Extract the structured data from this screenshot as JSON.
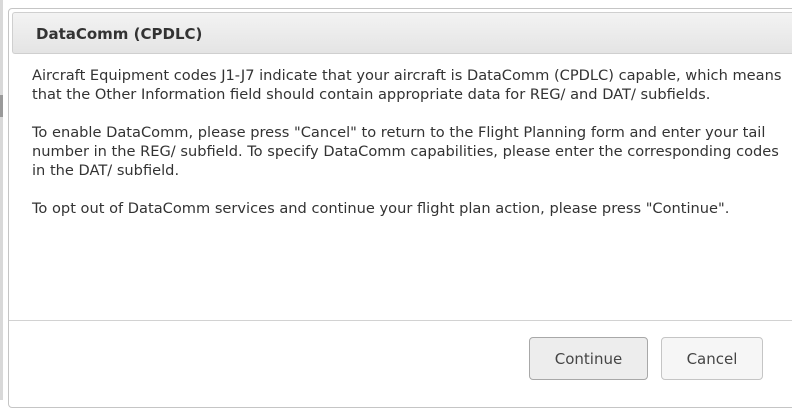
{
  "dialog": {
    "title": "DataComm (CPDLC)",
    "paragraphs": [
      "Aircraft Equipment codes J1-J7 indicate that your aircraft is DataComm (CPDLC) capable, which means that the Other Information field should contain appropriate data for REG/ and DAT/ subfields.",
      "To enable DataComm, please press \"Cancel\" to return to the Flight Planning form and enter your tail number in the REG/ subfield. To specify DataComm capabilities, please enter the corresponding codes in the DAT/ subfield.",
      "To opt out of DataComm services and continue your flight plan action, please press \"Continue\"."
    ],
    "buttons": {
      "continue_label": "Continue",
      "cancel_label": "Cancel"
    }
  },
  "colors": {
    "title_bar": "#e8e8e8",
    "border": "#c5c5c5",
    "text": "#333333"
  }
}
